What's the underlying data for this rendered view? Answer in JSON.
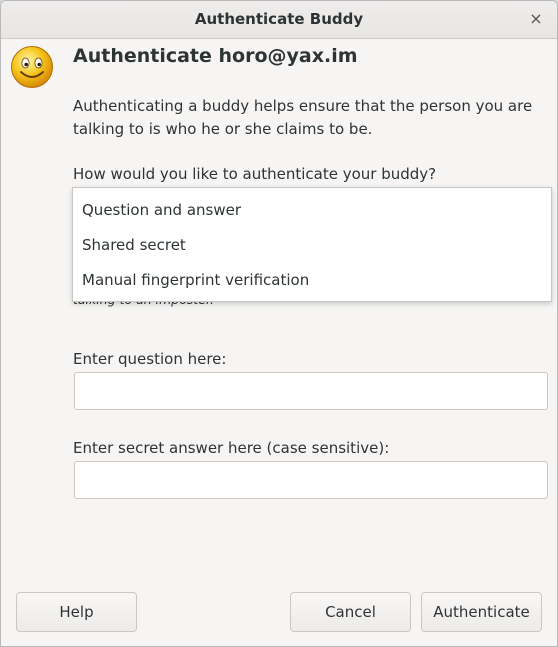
{
  "window": {
    "title": "Authenticate Buddy",
    "close_glyph": "×"
  },
  "header": {
    "heading": "Authenticate horo@yax.im",
    "icon": "smiley-face-icon"
  },
  "body": {
    "description": "Authenticating a buddy helps ensure that the person you are talking to is who he or she claims to be.",
    "method_question": "How would you like to authenticate your buddy?",
    "partial_hint": "talking to an imposter."
  },
  "method_dropdown": {
    "options": [
      "Question and answer",
      "Shared secret",
      "Manual fingerprint verification"
    ]
  },
  "form": {
    "question_label": "Enter question here:",
    "question_value": "",
    "answer_label": "Enter secret answer here (case sensitive):",
    "answer_value": ""
  },
  "buttons": {
    "help": "Help",
    "cancel": "Cancel",
    "authenticate": "Authenticate"
  },
  "colors": {
    "window_bg": "#f6f5f4",
    "face_yellow": "#f5c518",
    "text": "#2e3436"
  }
}
